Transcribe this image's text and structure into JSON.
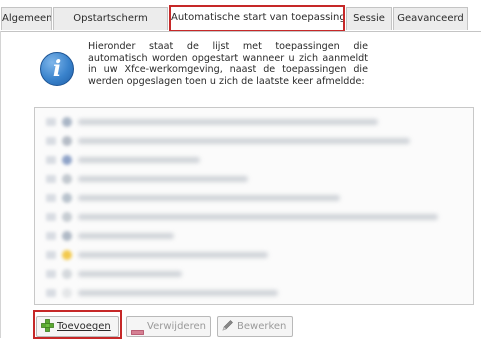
{
  "tabs": [
    {
      "label": "Algemeen",
      "active": false
    },
    {
      "label": "Opstartscherm",
      "active": false
    },
    {
      "label": "Automatische start van toepassing",
      "active": true
    },
    {
      "label": "Sessie",
      "active": false
    },
    {
      "label": "Geavanceerd",
      "active": false
    }
  ],
  "info": {
    "icon": "info-icon",
    "lines": [
      "Hieronder staat de lijst met toepassingen die",
      "automatisch worden opgestart wanneer u zich aanmeldt",
      "in uw Xfce-werkomgeving, naast de toepassingen die",
      "werden opgeslagen toen u zich de laatste keer afmeldde:"
    ]
  },
  "autostart_list": {
    "blurred": true,
    "rows": [
      {
        "icon_color": "#aab6c6"
      },
      {
        "icon_color": "#b5bcc6"
      },
      {
        "icon_color": "#8fa3c8"
      },
      {
        "icon_color": "#c2c8cf"
      },
      {
        "icon_color": "#b8c2cc"
      },
      {
        "icon_color": "#c6ccd2"
      },
      {
        "icon_color": "#b0bac6"
      },
      {
        "icon_color": "#f2c94c"
      },
      {
        "icon_color": "#d4d8dc"
      },
      {
        "icon_color": "#e4e6e8"
      }
    ]
  },
  "buttons": {
    "add": {
      "label": "Toevoegen",
      "icon": "plus-icon",
      "color": "#5aa832"
    },
    "remove": {
      "label": "Verwijderen",
      "icon": "minus-icon",
      "enabled": false,
      "color": "#c0506a"
    },
    "edit": {
      "label": "Bewerken",
      "icon": "pencil-icon",
      "enabled": false
    }
  },
  "colors": {
    "highlight": "#c62828",
    "info_blue": "#3a83cc"
  }
}
